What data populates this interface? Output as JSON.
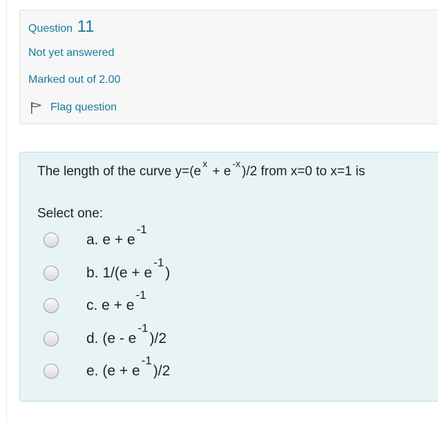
{
  "info": {
    "question_label": "Question",
    "question_number": "11",
    "state": "Not yet answered",
    "grade": "Marked out of 2.00",
    "flag_label": "Flag question",
    "flag_icon": "flag-icon"
  },
  "question": {
    "text_part1": "The length of the curve y=(e",
    "exp1": "x",
    "text_part2": " + e",
    "exp2": "-x",
    "text_part3": ")/2 from x=0 to x=1 is",
    "prompt": "Select one:",
    "options": [
      {
        "before": "a. e + e",
        "exp": "-1",
        "after": ""
      },
      {
        "before": "b. 1/(e + e",
        "exp": "-1",
        "after": ")"
      },
      {
        "before": "c. e + e",
        "exp": "-1",
        "after": ""
      },
      {
        "before": "d. (e - e",
        "exp": "-1",
        "after": ")/2"
      },
      {
        "before": "e. (e + e",
        "exp": "-1",
        "after": ")/2"
      }
    ]
  },
  "colors": {
    "accent": "#1a7a99",
    "question_bg": "#e7f3f5",
    "info_bg": "#f7f7f7"
  }
}
